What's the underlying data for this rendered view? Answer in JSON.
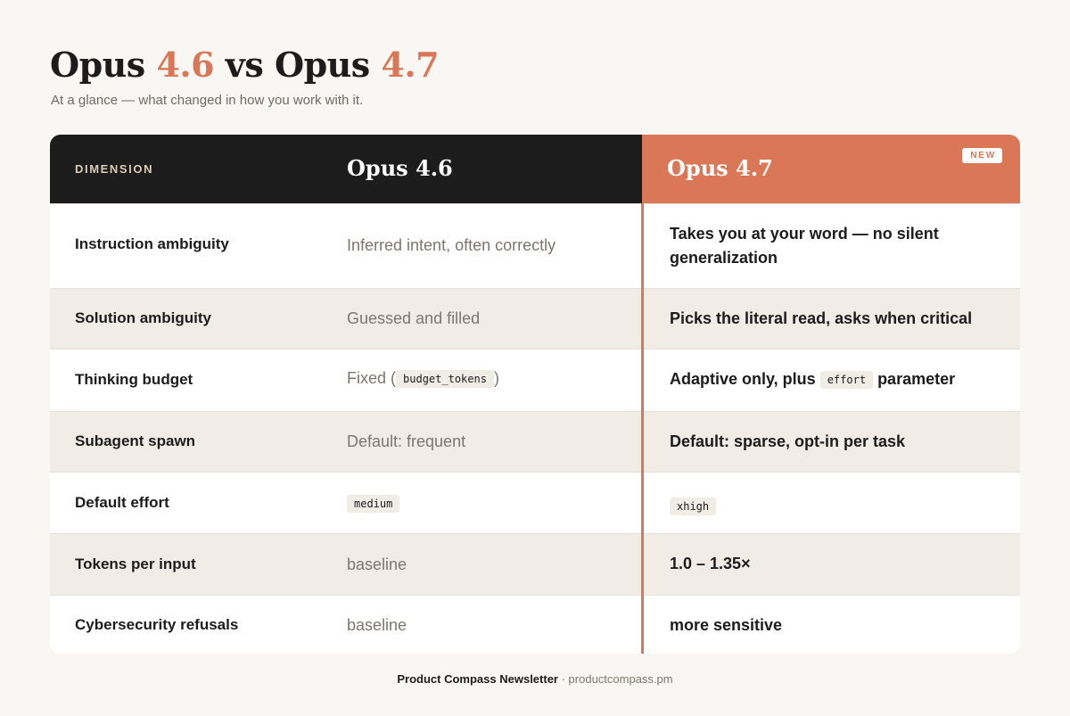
{
  "header": {
    "title_part1": "Opus ",
    "title_v1": "4.6",
    "title_part2": " vs Opus ",
    "title_v2": "4.7",
    "subtitle": "At a glance — what changed in how you work with it."
  },
  "table": {
    "column_dimension": "DIMENSION",
    "column_old": "Opus 4.6",
    "column_new": "Opus 4.7",
    "badge": "NEW",
    "rows": [
      {
        "dimension": "Instruction ambiguity",
        "old": "Inferred intent, often correctly",
        "new": "Takes you at your word — no silent generalization"
      },
      {
        "dimension": "Solution ambiguity",
        "old": "Guessed and filled",
        "new": "Picks the literal read, asks when critical"
      },
      {
        "dimension": "Thinking budget",
        "old_prefix": "Fixed (",
        "old_code": "budget_tokens",
        "old_suffix": ")",
        "new_prefix": "Adaptive only, plus ",
        "new_code": "effort",
        "new_suffix": " parameter"
      },
      {
        "dimension": "Subagent spawn",
        "old": "Default: frequent",
        "new": "Default: sparse, opt-in per task"
      },
      {
        "dimension": "Default effort",
        "old_code": "medium",
        "new_code": "xhigh"
      },
      {
        "dimension": "Tokens per input",
        "old": "baseline",
        "new": "1.0 – 1.35×"
      },
      {
        "dimension": "Cybersecurity refusals",
        "old": "baseline",
        "new": "more sensitive"
      }
    ]
  },
  "footer": {
    "brand": "Product Compass Newsletter",
    "separator": " · ",
    "url": "productcompass.pm"
  },
  "colors": {
    "accent": "#d97757",
    "dark": "#1c1c1c",
    "background": "#f9f7f3",
    "stripe": "#f1ede6"
  }
}
